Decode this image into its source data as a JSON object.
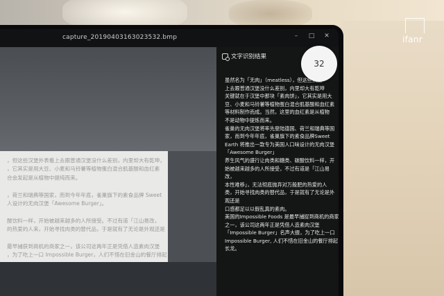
{
  "window": {
    "filename": "capture_20190403163023532.bmp",
    "controls": [
      "–",
      "□",
      "✕"
    ]
  },
  "preview_doc": {
    "lines": [
      "，但这些汉堡外表看上去跟普通汉堡没什么差别，内里却大有乾坤，",
      "，它其实是用大豆、小麦和马铃薯等植物蛋白混合肌基酸和血红素",
      "合会发起是从植物中提纯而来。",
      "",
      "，荷兰和瑞典等国家，而到今年年底，雀巢旗下的素食品牌 Sweet",
      "人设计的无肉汉堡「Awesome Burger」。",
      "",
      "酸饮料一样，开始被越来越多的人所接受。不过有道「江山易改，",
      "的热爱的人来，开始寻找肉类的替代品，于是就有了无论是外观还是",
      "",
      "最早捕获到商机的商家之一，该公司这两年正是凭借人造素肉汉堡",
      "，为了吃上一口 Impossible Burger，人们不惜在旧金山的餐厅排起"
    ]
  },
  "ocr_panel": {
    "title": "文字识别结果",
    "lines": [
      "虽然名为「无肉」（meatless），但这些汉堡",
      "上去跟普通汉堡没什么差别，内里却大有乾坤",
      "关键就在于汉堡中那块「素肉饼」，它其实是用大",
      "豆、小麦和马铃薯等植物蛋白混合肌基酸和血红素",
      "等材料制作而成。当然，这里的血红素是从植物",
      "不是动物中提炼而来。",
      "雀巢的无肉汉堡将率先登陆德国、荷兰和瑞典等国",
      "家，而到今年年底，雀巢旗下的素食品牌Sweet",
      "Earth 将推出一款专为美国人口味设计的无肉汉堡",
      "「Awesome Burger」",
      "养生风气的盛行让肉类和糖类、碳酸饮料一样，开",
      "始被越来越多的人所接受，不过有道是「江山易",
      "改，",
      "本性难移」，无法彻底抛弃对万般肥的热爱的人",
      "类，开始寻找肉类的替代品，于是就有了无论是外",
      "观还是",
      "口感都足以以假乱真的素肉。",
      "美国的Impossible Foods 是最早捕捉到商机的商家",
      "之一，该公司这两年正是凭借人造素肉汉堡",
      "「Impossible Burger」名声大振，为了吃上一口",
      "Impossible Burger, 人们不惜在旧金山的餐厅排起",
      "长龙。"
    ]
  },
  "badge": {
    "value": "32"
  },
  "watermark": {
    "text": "ifanr"
  }
}
